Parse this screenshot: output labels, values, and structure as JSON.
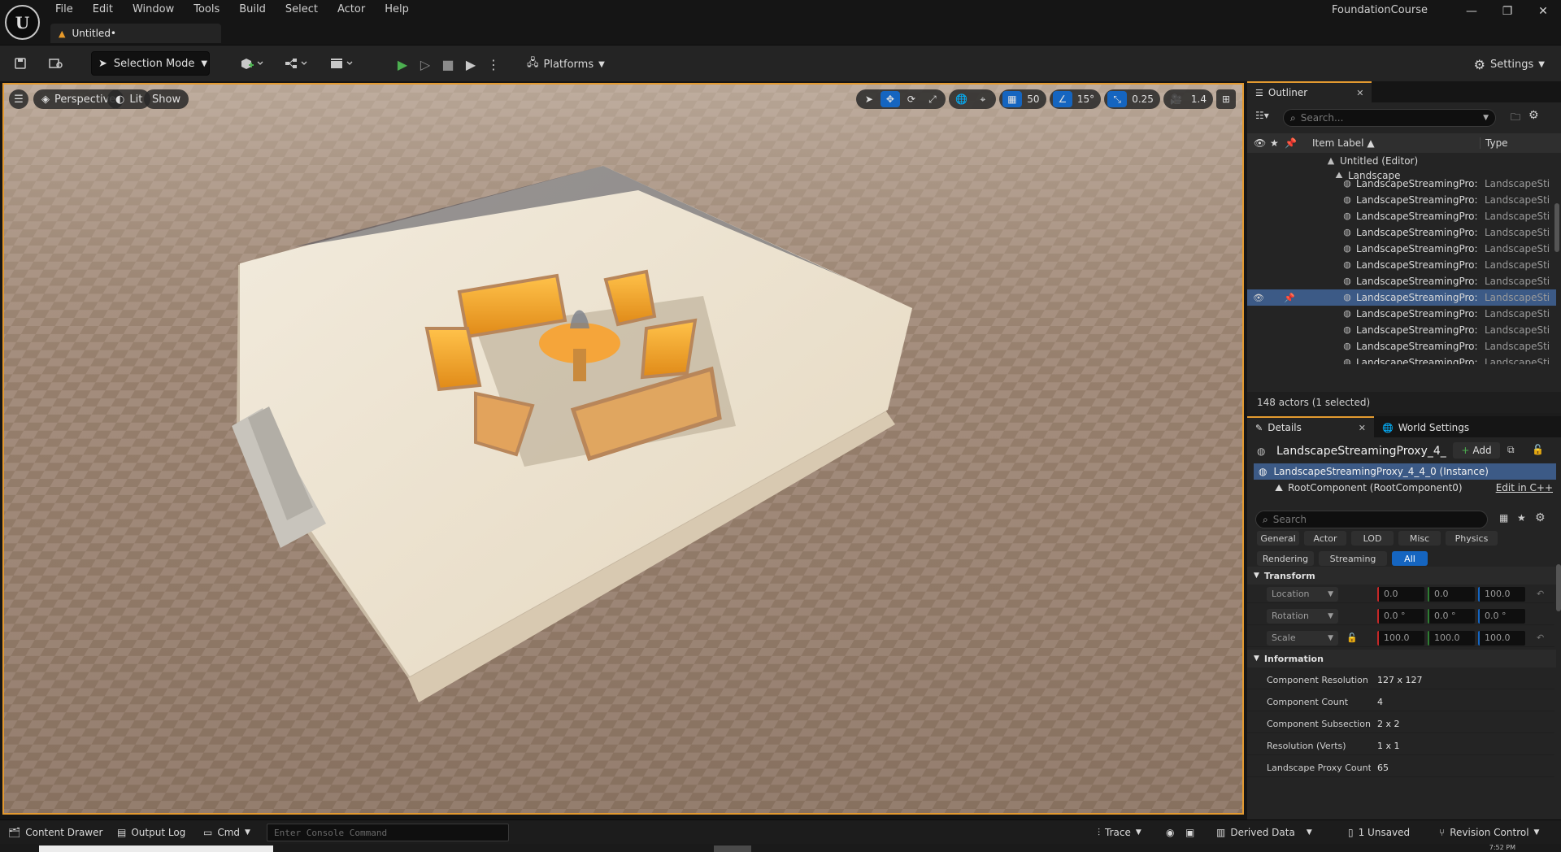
{
  "app": {
    "logo_letter": "U",
    "menu": [
      "File",
      "Edit",
      "Window",
      "Tools",
      "Build",
      "Select",
      "Actor",
      "Help"
    ],
    "document_tab": "Untitled•",
    "project_name": "FoundationCourse",
    "window_controls": [
      "—",
      "❐",
      "✕"
    ]
  },
  "toolbar": {
    "selection_mode": "Selection Mode",
    "platforms": "Platforms",
    "settings": "Settings"
  },
  "viewport": {
    "menu_icon": "hamburger-icon",
    "perspective": "Perspective",
    "lit": "Lit",
    "show": "Show",
    "grid_snap": "50",
    "rotation_snap": "15°",
    "scale_snap": "0.25",
    "camera_speed": "1.4",
    "colors": {
      "border": "#e39a30",
      "floor": "#8a7361",
      "platform": "#e8dcc6",
      "chairs": "#f0a030"
    }
  },
  "outliner": {
    "tab": "Outliner",
    "search_placeholder": "Search...",
    "col_label": "Item Label ▲",
    "col_type": "Type",
    "root": "Untitled (Editor)",
    "landscape": "Landscape",
    "rows": [
      {
        "label": "LandscapeStreamingPro:",
        "type": "LandscapeSti",
        "selected": false
      },
      {
        "label": "LandscapeStreamingPro:",
        "type": "LandscapeSti",
        "selected": false
      },
      {
        "label": "LandscapeStreamingPro:",
        "type": "LandscapeSti",
        "selected": false
      },
      {
        "label": "LandscapeStreamingPro:",
        "type": "LandscapeSti",
        "selected": false
      },
      {
        "label": "LandscapeStreamingPro:",
        "type": "LandscapeSti",
        "selected": false
      },
      {
        "label": "LandscapeStreamingPro:",
        "type": "LandscapeSti",
        "selected": false
      },
      {
        "label": "LandscapeStreamingPro:",
        "type": "LandscapeSti",
        "selected": false
      },
      {
        "label": "LandscapeStreamingPro:",
        "type": "LandscapeSti",
        "selected": true
      },
      {
        "label": "LandscapeStreamingPro:",
        "type": "LandscapeSti",
        "selected": false
      },
      {
        "label": "LandscapeStreamingPro:",
        "type": "LandscapeSti",
        "selected": false
      },
      {
        "label": "LandscapeStreamingPro:",
        "type": "LandscapeSti",
        "selected": false
      },
      {
        "label": "LandscapeStreamingPro:",
        "type": "LandscapeSti",
        "selected": false
      },
      {
        "label": "LandscapeStreamingPro:",
        "type": "LandscapeSti",
        "selected": false
      }
    ],
    "footer": "148 actors (1 selected)"
  },
  "details": {
    "tab": "Details",
    "world_settings_tab": "World Settings",
    "actor_name": "LandscapeStreamingProxy_4_",
    "add_label": "Add",
    "instance": "LandscapeStreamingProxy_4_4_0 (Instance)",
    "root_component": "RootComponent (RootComponent0)",
    "edit_cpp": "Edit in C++",
    "search_placeholder": "Search",
    "filters_row1": [
      "General",
      "Actor",
      "LOD",
      "Misc",
      "Physics"
    ],
    "filters_row2": [
      "Rendering",
      "Streaming",
      "All"
    ],
    "transform": {
      "header": "Transform",
      "location_label": "Location",
      "location": [
        "0.0",
        "0.0",
        "100.0"
      ],
      "rotation_label": "Rotation",
      "rotation": [
        "0.0 °",
        "0.0 °",
        "0.0 °"
      ],
      "scale_label": "Scale",
      "scale": [
        "100.0",
        "100.0",
        "100.0"
      ]
    },
    "information": {
      "header": "Information",
      "rows": [
        {
          "name": "Component Resolution (\\",
          "value": "127 x 127"
        },
        {
          "name": "Component Count",
          "value": "4"
        },
        {
          "name": "Component Subsections",
          "value": "2 x 2"
        },
        {
          "name": "Resolution (Verts)",
          "value": "1 x 1"
        },
        {
          "name": "Landscape Proxy Count",
          "value": "65"
        }
      ]
    }
  },
  "statusbar": {
    "content_drawer": "Content Drawer",
    "output_log": "Output Log",
    "cmd": "Cmd",
    "console_placeholder": "Enter Console Command",
    "trace": "Trace",
    "derived_data": "Derived Data",
    "unsaved": "1 Unsaved",
    "revision_control": "Revision Control"
  },
  "taskbar": {
    "time": "7:52 PM"
  }
}
